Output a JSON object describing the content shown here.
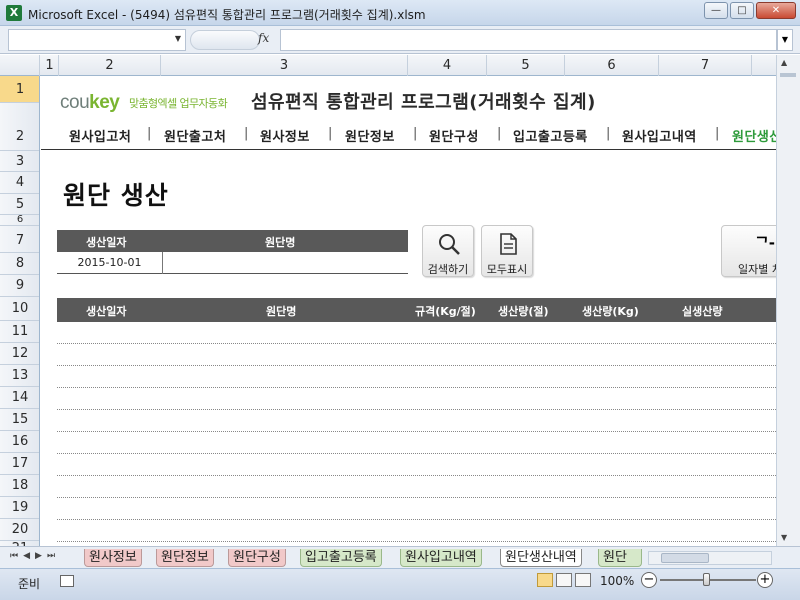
{
  "window": {
    "title": "Microsoft Excel - (5494) 섬유편직 통합관리 프로그램(거래횟수 집계).xlsm",
    "app_icon": "X",
    "minimize": "—",
    "maximize": "□",
    "close": "✕"
  },
  "formula_bar": {
    "name_box": "",
    "fx": "fx",
    "value": ""
  },
  "columns": [
    "1",
    "2",
    "3",
    "4",
    "5",
    "6",
    "7"
  ],
  "rows": [
    "1",
    "2",
    "3",
    "4",
    "5",
    "6",
    "7",
    "8",
    "9",
    "10",
    "11",
    "12",
    "13",
    "14",
    "15",
    "16",
    "17",
    "18",
    "19",
    "20",
    "21"
  ],
  "header": {
    "logo_cou": "cou",
    "logo_key": "key",
    "logo_tagline": "맞춤형엑셀 업무자동화",
    "program_title": "섬유편직 통합관리 프로그램(거래횟수 집계)"
  },
  "nav": {
    "items": [
      "원사입고처",
      "원단출고처",
      "원사정보",
      "원단정보",
      "원단구성",
      "입고출고등록",
      "원사입고내역",
      "원단생산"
    ],
    "active": "원단생산"
  },
  "page_heading": "원단 생산",
  "filter": {
    "date_label": "생산일자",
    "name_label": "원단명",
    "date_value": "2015-10-01",
    "name_value": ""
  },
  "buttons": {
    "search": "검색하기",
    "show_all": "모두표시",
    "by_date": "일자별 처"
  },
  "table": {
    "headers": [
      "생산일자",
      "원단명",
      "규격(Kg/절)",
      "생산량(절)",
      "생산량(Kg)",
      "실생산량"
    ]
  },
  "sheet_tabs": [
    {
      "label": "원사정보",
      "color": "#f1c9c9"
    },
    {
      "label": "원단정보",
      "color": "#f1c9c9"
    },
    {
      "label": "원단구성",
      "color": "#f1c9c9"
    },
    {
      "label": "입고출고등록",
      "color": "#d6e8c9"
    },
    {
      "label": "원사입고내역",
      "color": "#d6e8c9"
    },
    {
      "label": "원단생산내역",
      "color": "#ffffff"
    },
    {
      "label": "원단",
      "color": "#d6e8c9"
    }
  ],
  "active_sheet": "원단생산내역",
  "status": {
    "ready": "준비",
    "zoom": "100%"
  },
  "colors": {
    "accent_green": "#2d9a3a",
    "logo_green": "#7ab531",
    "table_header": "#595959",
    "selected_row_header": "#f8d98b"
  }
}
